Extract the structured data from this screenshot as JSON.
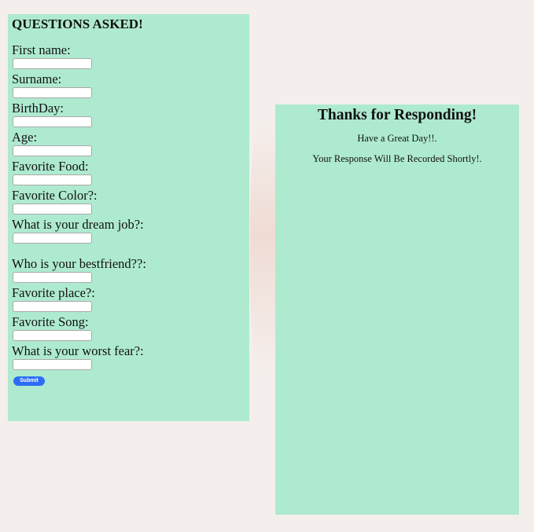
{
  "form": {
    "title": "QUESTIONS ASKED!",
    "fields": [
      {
        "label": "First name:",
        "value": ""
      },
      {
        "label": "Surname:",
        "value": ""
      },
      {
        "label": "BirthDay:",
        "value": ""
      },
      {
        "label": "Age:",
        "value": ""
      },
      {
        "label": "Favorite Food:",
        "value": ""
      },
      {
        "label": "Favorite Color?:",
        "value": ""
      },
      {
        "label": "What is your dream job?:",
        "value": ""
      },
      {
        "label": "Who is your bestfriend??:",
        "value": ""
      },
      {
        "label": "Favorite place?:",
        "value": ""
      },
      {
        "label": "Favorite Song:",
        "value": ""
      },
      {
        "label": "What is your worst fear?:",
        "value": ""
      }
    ],
    "submit_label": "Submit"
  },
  "thanks": {
    "title": "Thanks for Responding!",
    "line1": "Have a Great Day!!.",
    "line2": "Your Response Will Be Recorded Shortly!."
  },
  "colors": {
    "page_background": "#f4efec",
    "panel_background": "#aeead0",
    "submit_button": "#2d6df6"
  }
}
